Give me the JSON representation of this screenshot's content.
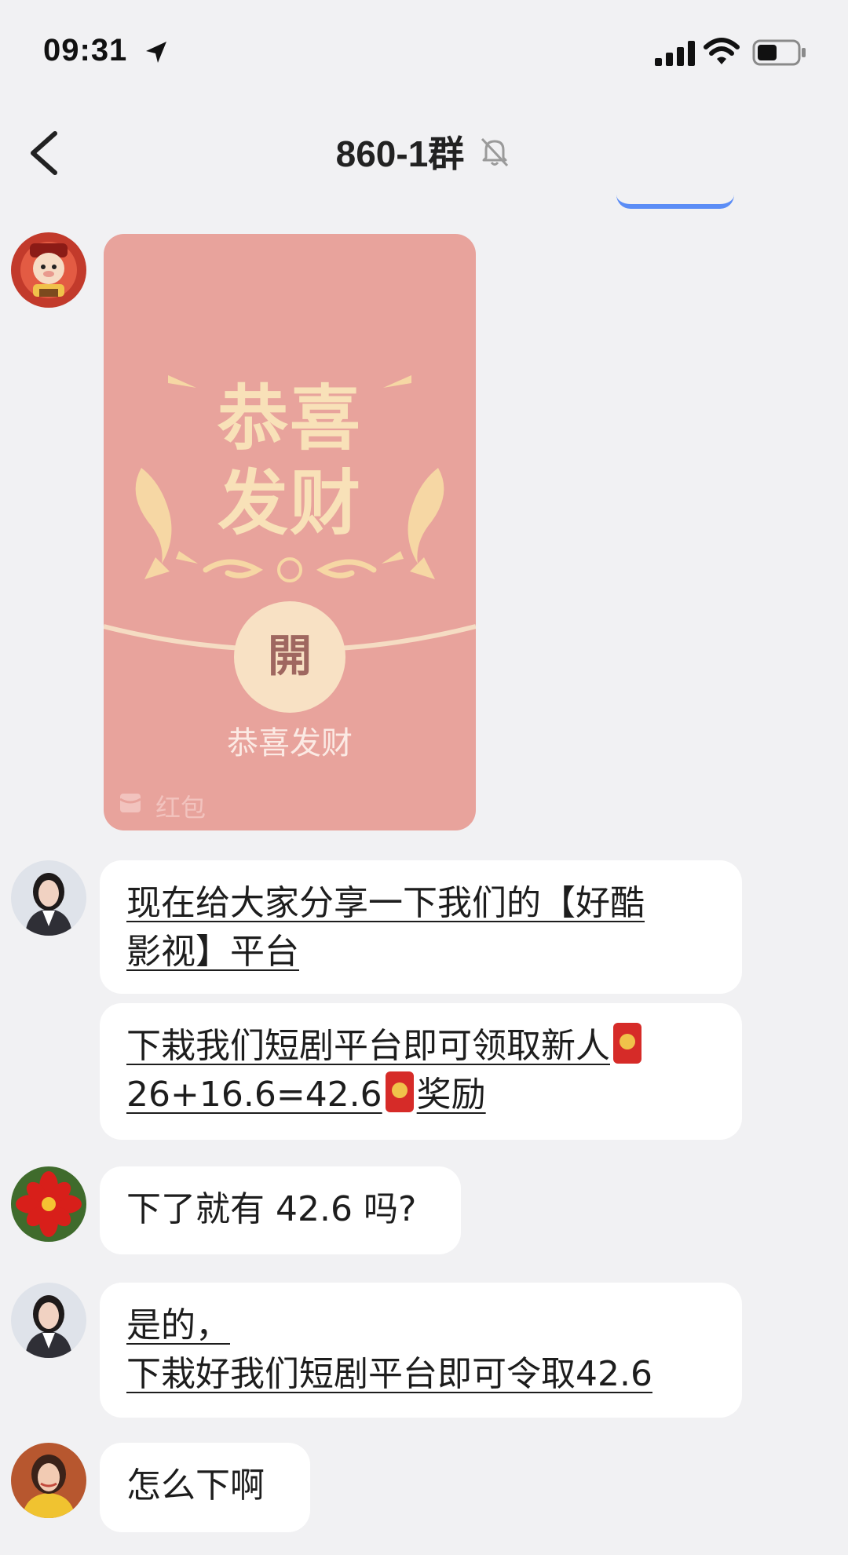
{
  "status_bar": {
    "time": "09:31"
  },
  "header": {
    "title": "860-1群"
  },
  "red_packet": {
    "title_line1": "恭喜",
    "title_line2": "发财",
    "open_label": "開",
    "greeting": "恭喜发财",
    "footer_label": "红包"
  },
  "messages": [
    {
      "id": "m1",
      "parts": [
        "现在给大家分享一下我们的【好酷",
        "影视】平台"
      ]
    },
    {
      "id": "m2",
      "parts": [
        "下栽我们短剧平台即可领取新人",
        "26+16.6=42.6",
        "奖励"
      ]
    },
    {
      "id": "m3",
      "parts": [
        "下了就有 42.6 吗?"
      ]
    },
    {
      "id": "m4",
      "parts": [
        "是的，",
        "下栽好我们短剧平台即可令取42.6"
      ]
    },
    {
      "id": "m5",
      "parts": [
        "怎么下啊"
      ]
    }
  ],
  "colors": {
    "background": "#f1f1f3",
    "bubble": "#ffffff",
    "red_packet": "#e8a39c",
    "red_packet_gold": "#f8e1b8"
  }
}
